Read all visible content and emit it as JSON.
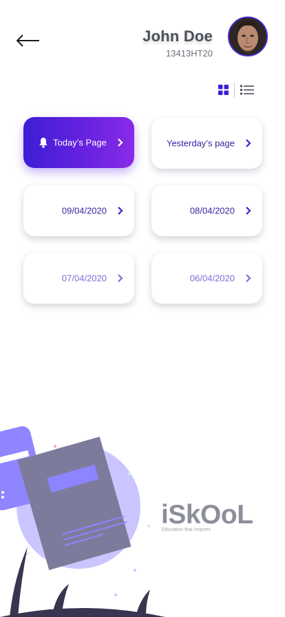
{
  "header": {
    "back_label": "Back",
    "user_name": "John Doe",
    "user_id": "13413HT20"
  },
  "view_toggle": {
    "grid": "grid-view-icon",
    "list": "list-view-icon",
    "active": "grid"
  },
  "pages": [
    {
      "label": "Today’s Page",
      "active": true,
      "icon": "bell-icon"
    },
    {
      "label": "Yesterday’s page",
      "active": false
    },
    {
      "label": "09/04/2020",
      "active": false
    },
    {
      "label": "08/04/2020",
      "active": false
    },
    {
      "label": "07/04/2020",
      "active": false
    },
    {
      "label": "06/04/2020",
      "active": false
    }
  ],
  "brand": {
    "name": "iSkOoL",
    "tagline": "Education that inspires"
  },
  "colors": {
    "accent_start": "#3d1ed6",
    "accent_end": "#8a2be8",
    "card_text": "#3a1f9e",
    "brand_gray": "#8c8f99",
    "illustration_purple": "#c8c2ff"
  }
}
